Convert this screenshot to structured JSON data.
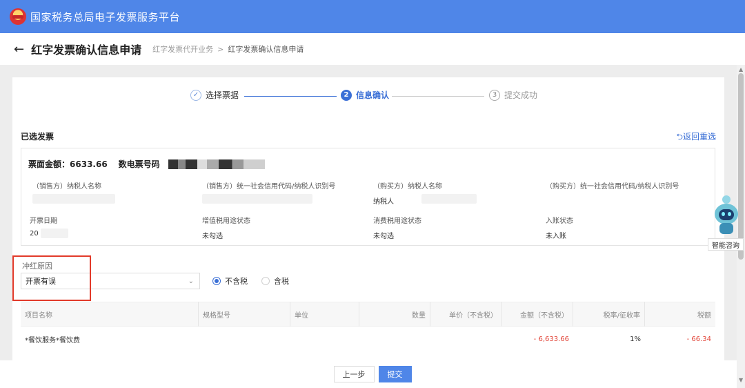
{
  "app": {
    "title": "国家税务总局电子发票服务平台"
  },
  "header": {
    "page_title": "红字发票确认信息申请",
    "breadcrumb": [
      "红字发票代开业务",
      "红字发票确认信息申请"
    ],
    "breadcrumb_sep": ">"
  },
  "steps": [
    {
      "num": "✓",
      "label": "选择票据",
      "state": "done"
    },
    {
      "num": "2",
      "label": "信息确认",
      "state": "active"
    },
    {
      "num": "3",
      "label": "提交成功",
      "state": "pending"
    }
  ],
  "section": {
    "title": "已选发票",
    "reselect": "⮌返回重选"
  },
  "invoice": {
    "amount_label": "票面金额：",
    "amount_value": "6633.66",
    "number_label": "数电票号码",
    "fields": [
      {
        "label": "（销售方）纳税人名称",
        "value": ""
      },
      {
        "label": "（销售方）统一社会信用代码/纳税人识别号",
        "value": ""
      },
      {
        "label": "（购买方）纳税人名称",
        "value": "纳税人"
      },
      {
        "label": "（购买方）统一社会信用代码/纳税人识别号",
        "value": ""
      },
      {
        "label": "开票日期",
        "value": "20"
      },
      {
        "label": "增值税用途状态",
        "value": "未勾选"
      },
      {
        "label": "消费税用途状态",
        "value": "未勾选"
      },
      {
        "label": "入账状态",
        "value": "未入账"
      }
    ]
  },
  "reason": {
    "label": "冲红原因",
    "selected": "开票有误"
  },
  "tax_mode": {
    "options": [
      "不含税",
      "含税"
    ],
    "selected": "不含税"
  },
  "table": {
    "headers": [
      "项目名称",
      "规格型号",
      "单位",
      "数量",
      "单价（不含税）",
      "金额（不含税）",
      "税率/征收率",
      "税额"
    ],
    "rows": [
      [
        "*餐饮服务*餐饮费",
        "",
        "",
        "",
        "",
        "- 6,633.66",
        "1%",
        "- 66.34"
      ]
    ]
  },
  "footer": {
    "prev": "上一步",
    "submit": "提交"
  },
  "assistant": {
    "label": "智能咨询"
  },
  "colors": {
    "brand": "#4f86e8",
    "accent": "#3a6fd6",
    "negative": "#e2463a",
    "highlight": "#e23a2a"
  }
}
